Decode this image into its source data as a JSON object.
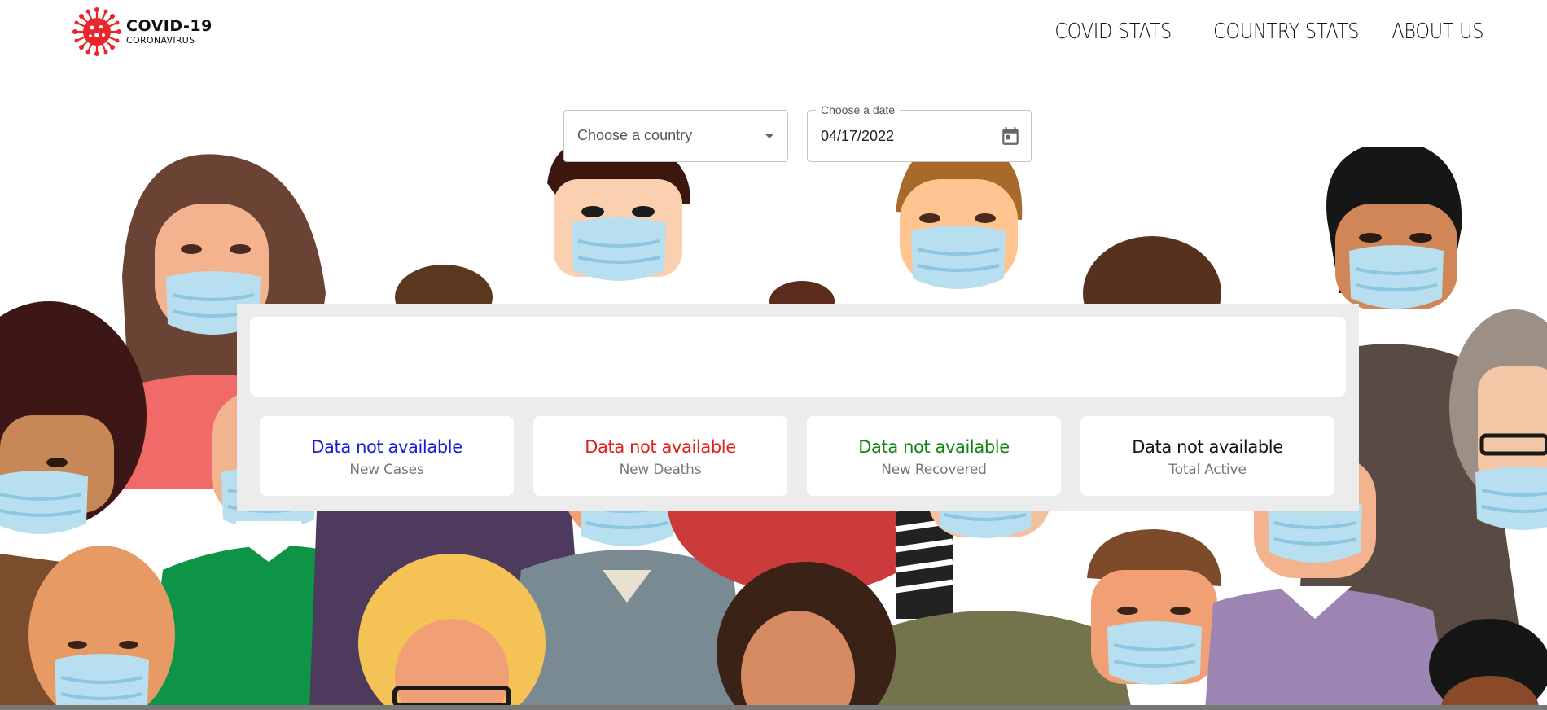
{
  "header": {
    "logo_title": "COVID-19",
    "logo_subtitle": "CORONAVIRUS",
    "nav": [
      "COVID STATS",
      "COUNTRY STATS",
      "ABOUT US"
    ]
  },
  "controls": {
    "country_placeholder": "Choose a country",
    "date_label": "Choose a date",
    "date_value": "04/17/2022"
  },
  "stats": [
    {
      "value": "Data not available",
      "label": "New Cases",
      "color": "#1a1ad6"
    },
    {
      "value": "Data not available",
      "label": "New Deaths",
      "color": "#e0201c"
    },
    {
      "value": "Data not available",
      "label": "New Recovered",
      "color": "#128212"
    },
    {
      "value": "Data not available",
      "label": "Total Active",
      "color": "#111111"
    }
  ],
  "colors": {
    "brand_red": "#e8262b"
  }
}
